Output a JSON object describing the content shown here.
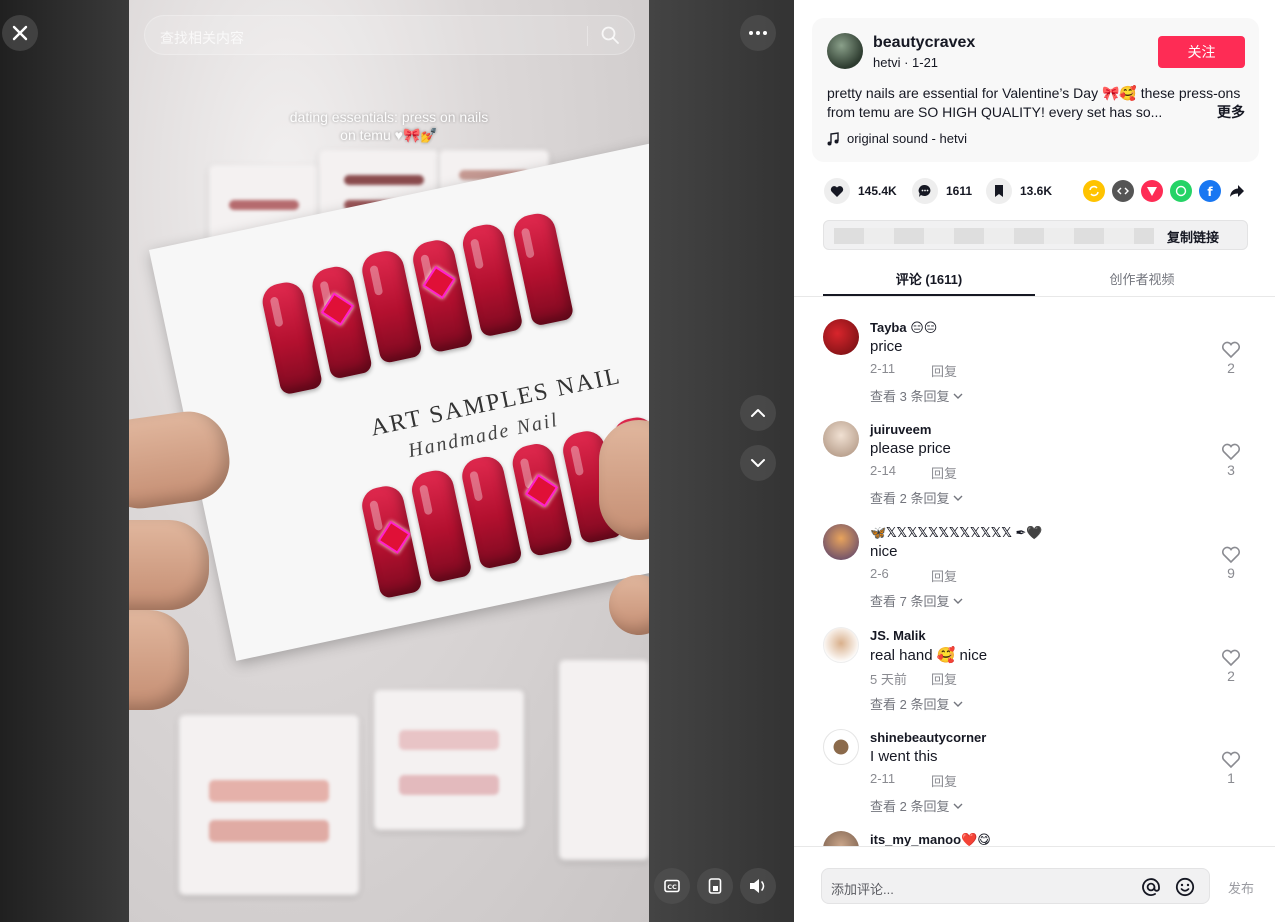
{
  "search": {
    "placeholder": "查找相关内容"
  },
  "video": {
    "caption": "dating essentials: press on nails on temu ♥🎀💅",
    "card_title": "ART SAMPLES NAIL",
    "card_subtitle": "Handmade Nail"
  },
  "author": {
    "name": "beautycravex",
    "meta": "hetvi · 1-21",
    "follow_label": "关注",
    "description": "pretty nails are essential for Valentine’s Day 🎀🥰 these press-ons from temu are SO HIGH QUALITY! every set has so...",
    "more_label": "更多",
    "sound": "original sound - hetvi"
  },
  "stats": {
    "likes": "145.4K",
    "comments": "1611",
    "saves": "13.6K"
  },
  "share_icons": [
    "repost-icon",
    "embed-icon",
    "send-icon",
    "whatsapp-icon",
    "facebook-icon",
    "share-arrow-icon"
  ],
  "link": {
    "copy_label": "复制链接"
  },
  "tabs": {
    "comments": "评论 (1611)",
    "creator_videos": "创作者视频"
  },
  "reply_label": "回复",
  "comments": [
    {
      "user": "Tayba 😑😑",
      "text": "price",
      "date": "2-11",
      "view_replies": "查看 3 条回复",
      "likes": "2"
    },
    {
      "user": "juiruveem",
      "text": "please price",
      "date": "2-14",
      "view_replies": "查看 2 条回复",
      "likes": "3"
    },
    {
      "user": "🦋𝕏𝕏𝕏𝕏𝕏𝕏𝕏𝕏𝕏𝕏𝕏𝕏 ✒🖤",
      "text": "nice",
      "date": "2-6",
      "view_replies": "查看 7 条回复",
      "likes": "9"
    },
    {
      "user": "JS. Malik",
      "text": "real hand 🥰 nice",
      "date": "5 天前",
      "view_replies": "查看 2 条回复",
      "likes": "2"
    },
    {
      "user": "shinebeautycorner",
      "text": "I went this",
      "date": "2-11",
      "view_replies": "查看 2 条回复",
      "likes": "1"
    },
    {
      "user": "its_my_manoo❤️😋",
      "text": "",
      "date": "",
      "view_replies": "",
      "likes": ""
    }
  ],
  "comment_input": {
    "placeholder": "添加评论...",
    "post_label": "发布"
  },
  "colors": {
    "accent": "#fe2c55",
    "text": "#161823",
    "muted": "#8a8b91"
  }
}
